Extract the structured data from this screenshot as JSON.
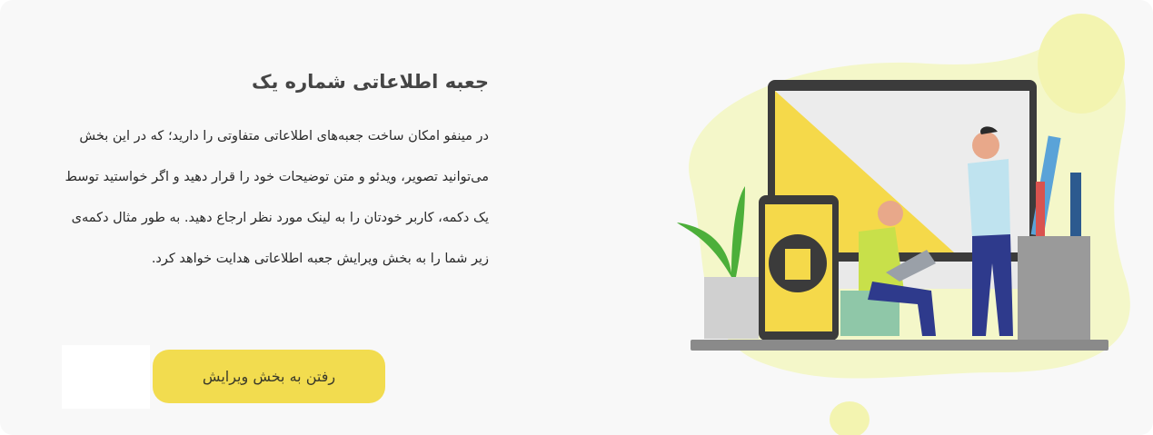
{
  "infobox": {
    "title": "جعبه اطلاعاتی شماره یک",
    "description": "در مینفو امکان ساخت جعبه‌های اطلاعاتی متفاوتی را دارید؛ که در این بخش می‌توانید تصویر، ویدئو و متن توضیحات خود را قرار دهید و اگر خواستید توسط یک دکمه، کاربر خودتان را به لینک مورد نظر ارجاع دهید. به طور مثال دکمه‌ی زیر شما را به بخش ویرایش جعبه اطلاعاتی هدایت خواهد کرد.",
    "button_label": "رفتن به بخش ویرایش",
    "illustration": "people-with-devices-illustration"
  },
  "colors": {
    "accent": "#f2dc4f",
    "blob": "#f4f7c9",
    "background": "#f8f8f8"
  }
}
